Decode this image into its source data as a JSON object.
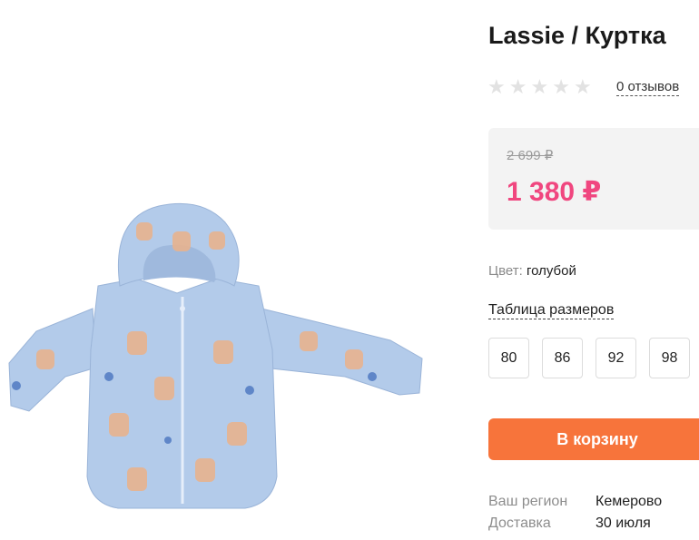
{
  "product": {
    "title": "Lassie / Куртка",
    "reviews_label": "0 отзывов",
    "rating": 0,
    "rating_max": 5,
    "image_alt": "product-photo-blue-jacket"
  },
  "price": {
    "old": "2 699 ₽",
    "current": "1 380 ₽",
    "current_color": "#f0467f"
  },
  "color": {
    "label": "Цвет:",
    "value": "голубой"
  },
  "size_table_label": "Таблица размеров",
  "sizes": [
    "80",
    "86",
    "92",
    "98"
  ],
  "cart_button_label": "В корзину",
  "cart_button_color": "#f7743b",
  "delivery_info": {
    "region_label": "Ваш регион",
    "region_value": "Кемерово",
    "delivery_label": "Доставка",
    "delivery_value": "30 июля"
  },
  "colors": {
    "jacket": "#b3cbea",
    "pattern": "#e8b38f"
  }
}
